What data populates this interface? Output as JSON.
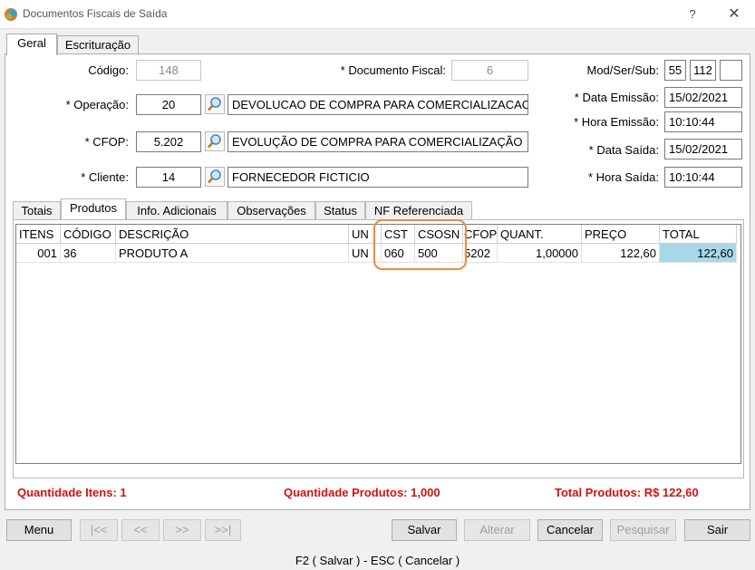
{
  "window": {
    "title": "Documentos Fiscais de Saída",
    "help": "?",
    "close": "✕"
  },
  "top_tabs": [
    "Geral",
    "Escrituração"
  ],
  "form": {
    "codigo_label": "Código:",
    "codigo_value": "148",
    "documento_label": "* Documento Fiscal:",
    "documento_value": "6",
    "modser_label": "Mod/Ser/Sub:",
    "mod": "55",
    "ser": "112",
    "sub": "",
    "operacao_label": "* Operação:",
    "operacao_code": "20",
    "operacao_desc": "DEVOLUCAO DE COMPRA PARA COMERCIALIZACAO",
    "cfop_label": "* CFOP:",
    "cfop_code": "5.202",
    "cfop_desc": "EVOLUÇÃO DE COMPRA PARA COMERCIALIZAÇÃO",
    "cliente_label": "* Cliente:",
    "cliente_code": "14",
    "cliente_desc": "FORNECEDOR FICTICIO",
    "data_emissao_label": "* Data Emissão:",
    "data_emissao": "15/02/2021",
    "hora_emissao_label": "* Hora Emissão:",
    "hora_emissao": "10:10:44",
    "data_saida_label": "* Data Saída:",
    "data_saida": "15/02/2021",
    "hora_saida_label": "* Hora Saída:",
    "hora_saida": "10:10:44"
  },
  "inner_tabs": [
    "Totais",
    "Produtos",
    "Info. Adicionais",
    "Observações",
    "Status",
    "NF Referenciada"
  ],
  "grid": {
    "headers": [
      "ITENS",
      "CÓDIGO",
      "DESCRIÇÃO",
      "UN",
      "CST",
      "CSOSN",
      "CFOP",
      "QUANT.",
      "PREÇO",
      "TOTAL"
    ],
    "rows": [
      [
        "001",
        "36",
        "PRODUTO A",
        "UN",
        "060",
        "500",
        "5202",
        "1,00000",
        "122,60",
        "122,60"
      ]
    ]
  },
  "totals": {
    "itens": "Quantidade Itens: 1",
    "produtos_qtd": "Quantidade Produtos: 1,000",
    "produtos_total": "Total Produtos: R$ 122,60"
  },
  "buttons": {
    "menu": "Menu",
    "first": "|<<",
    "prev": "<<",
    "next": ">>",
    "last": ">>|",
    "salvar": "Salvar",
    "alterar": "Alterar",
    "cancelar": "Cancelar",
    "pesquisar": "Pesquisar",
    "sair": "Sair"
  },
  "status": "F2 ( Salvar )   -   ESC ( Cancelar )",
  "colors": {
    "accent_total": "#d01212",
    "highlight": "#f08a3c",
    "selected_cell": "#a7d8e8"
  }
}
